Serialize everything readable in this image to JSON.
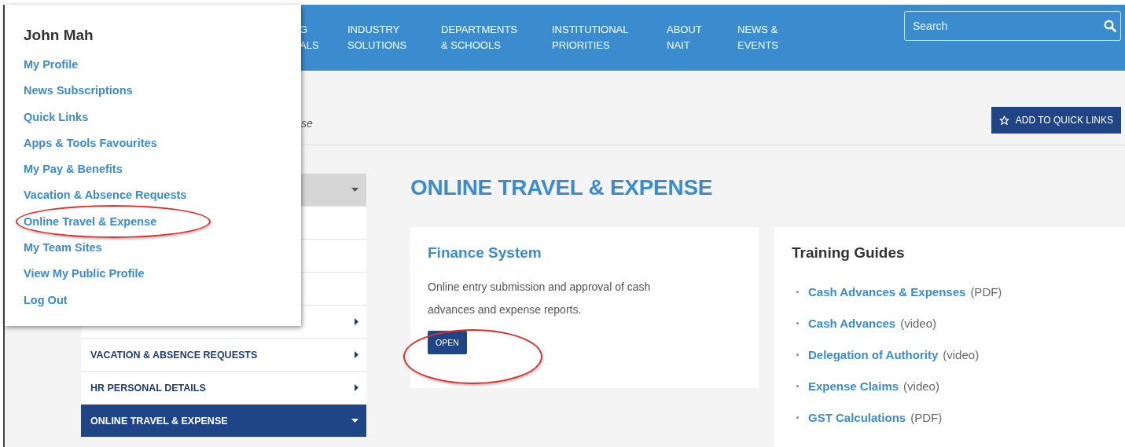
{
  "nav": {
    "items": [
      {
        "lines": [
          "G",
          "ALS"
        ]
      },
      {
        "lines": [
          "INDUSTRY",
          "SOLUTIONS"
        ]
      },
      {
        "lines": [
          "DEPARTMENTS",
          "& SCHOOLS"
        ]
      },
      {
        "lines": [
          "INSTITUTIONAL",
          "PRIORITIES"
        ]
      },
      {
        "lines": [
          "ABOUT",
          "NAIT"
        ]
      },
      {
        "lines": [
          "NEWS &",
          "EVENTS"
        ]
      }
    ],
    "search": {
      "placeholder": "Search"
    }
  },
  "breadcrumb": "se",
  "quick_links_button": "ADD TO QUICK LINKS",
  "user_menu": {
    "name": "John Mah",
    "items": [
      {
        "label": "My Profile",
        "circled": false
      },
      {
        "label": "News Subscriptions",
        "circled": false
      },
      {
        "label": "Quick Links",
        "circled": false
      },
      {
        "label": "Apps & Tools Favourites",
        "circled": false
      },
      {
        "label": "My Pay & Benefits",
        "circled": false
      },
      {
        "label": "Vacation & Absence Requests",
        "circled": false
      },
      {
        "label": "Online Travel & Expense",
        "circled": true
      },
      {
        "label": "My Team Sites",
        "circled": false
      },
      {
        "label": "View My Public Profile",
        "circled": false
      },
      {
        "label": "Log Out",
        "circled": false
      }
    ]
  },
  "sidebar": {
    "items": [
      {
        "kind": "header",
        "expanded": true,
        "selected": false
      },
      {
        "kind": "subitem",
        "selected": false
      },
      {
        "kind": "subitem",
        "selected": false
      },
      {
        "kind": "subitem",
        "selected": false
      },
      {
        "kind": "item",
        "expanded": false,
        "selected": false
      },
      {
        "kind": "item",
        "label": "VACATION & ABSENCE REQUESTS",
        "expanded": false,
        "selected": false
      },
      {
        "kind": "item",
        "label": "HR PERSONAL DETAILS",
        "expanded": false,
        "selected": false
      },
      {
        "kind": "item",
        "label": "ONLINE TRAVEL & EXPENSE",
        "expanded": true,
        "selected": true
      }
    ]
  },
  "page_title": "ONLINE TRAVEL & EXPENSE",
  "finance_card": {
    "title": "Finance System",
    "description": "Online entry submission and approval of cash advances and expense reports.",
    "button": "OPEN",
    "button_circled": true
  },
  "training_card": {
    "title": "Training Guides",
    "items": [
      {
        "link": "Cash Advances & Expenses",
        "note": "(PDF)"
      },
      {
        "link": "Cash Advances",
        "note": "(video)"
      },
      {
        "link": "Delegation of Authority",
        "note": "(video)"
      },
      {
        "link": "Expense Claims",
        "note": "(video)"
      },
      {
        "link": "GST Calculations",
        "note": "(PDF)"
      }
    ]
  }
}
